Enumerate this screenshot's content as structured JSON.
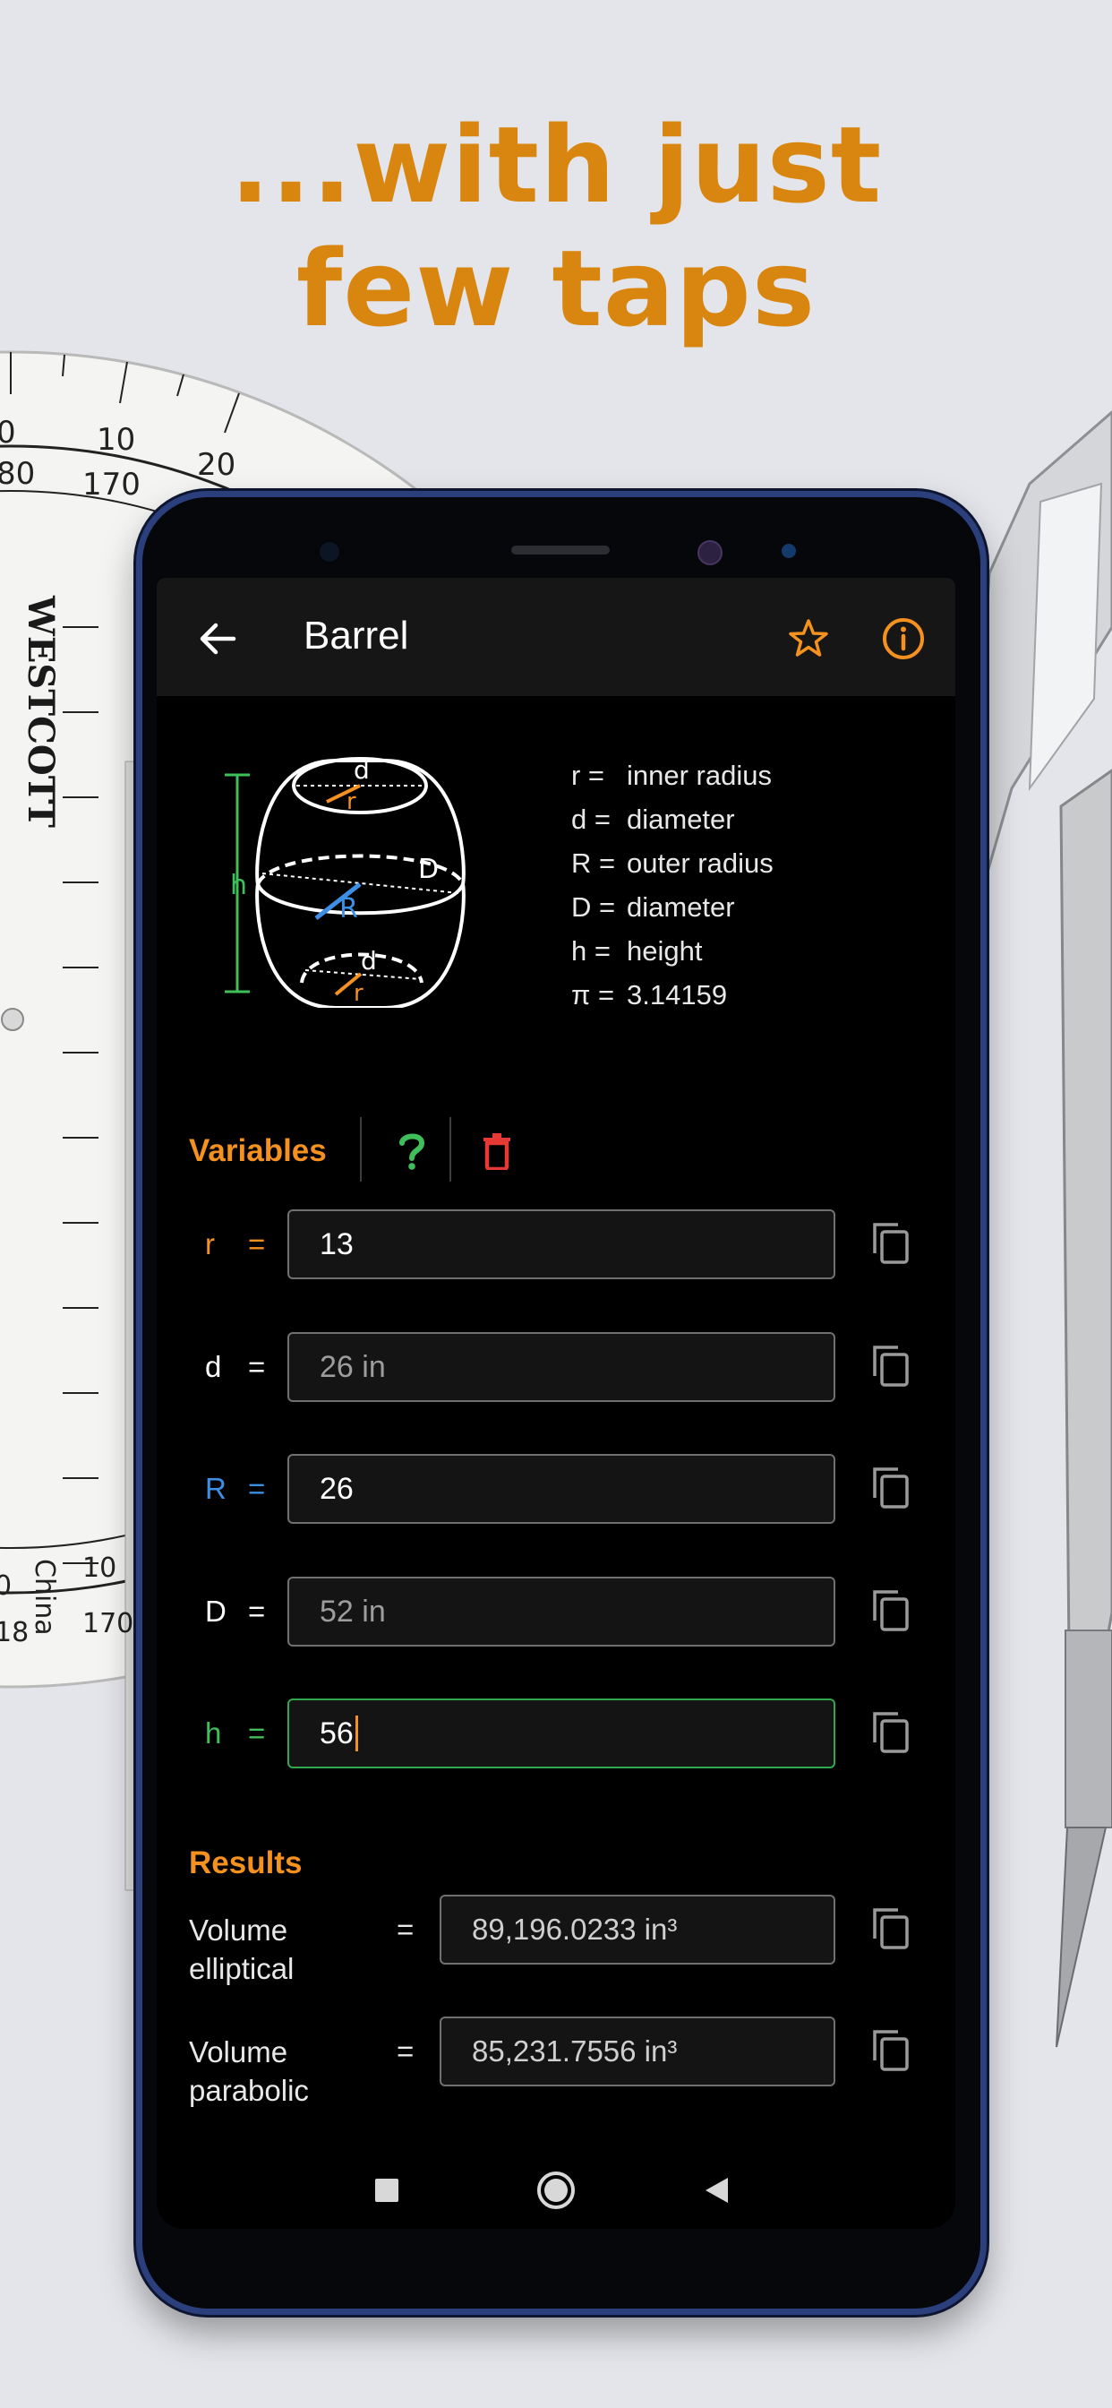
{
  "promo": {
    "line1": "...with just",
    "line2": "few taps"
  },
  "app": {
    "title": "Barrel",
    "back_icon": "arrow-left-icon",
    "favorite_icon": "star-outline-icon",
    "info_icon": "info-circle-icon"
  },
  "diagram": {
    "labels": {
      "d_top": "d",
      "r": "r",
      "D": "D",
      "R": "R",
      "d_bottom": "d",
      "r_bottom": "r",
      "h": "h"
    }
  },
  "legend": [
    {
      "sym": "r =",
      "desc": "inner radius"
    },
    {
      "sym": "d =",
      "desc": "diameter"
    },
    {
      "sym": "R =",
      "desc": "outer radius"
    },
    {
      "sym": "D =",
      "desc": "diameter"
    },
    {
      "sym": "h =",
      "desc": "height"
    },
    {
      "sym": "π =",
      "desc": "3.14159"
    }
  ],
  "variables": {
    "header": "Variables",
    "help_icon": "question-mark-icon",
    "clear_icon": "trash-icon",
    "rows": [
      {
        "label": "r",
        "eq": "=",
        "value": "13",
        "color": "#f5911e",
        "computed": false
      },
      {
        "label": "d",
        "eq": "=",
        "value": "26 in",
        "color": "#ffffff",
        "computed": true
      },
      {
        "label": "R",
        "eq": "=",
        "value": "26",
        "color": "#3d8fe6",
        "computed": false
      },
      {
        "label": "D",
        "eq": "=",
        "value": "52 in",
        "color": "#ffffff",
        "computed": true
      },
      {
        "label": "h",
        "eq": "=",
        "value": "56",
        "color": "#3fbf5a",
        "computed": false
      }
    ]
  },
  "results": {
    "header": "Results",
    "rows": [
      {
        "label_line1": "Volume",
        "label_line2": "elliptical",
        "eq": "=",
        "value": "89,196.0233 in³"
      },
      {
        "label_line1": "Volume",
        "label_line2": "parabolic",
        "eq": "=",
        "value": "85,231.7556 in³"
      }
    ]
  },
  "navbar": {
    "recents_icon": "square-icon",
    "home_icon": "circle-icon",
    "back_icon": "triangle-back-icon"
  },
  "colors": {
    "accent": "#f5911e",
    "promo": "#d8860f",
    "active_border": "#2fa84f",
    "delete": "#e53935",
    "help": "#3fbf5a"
  }
}
